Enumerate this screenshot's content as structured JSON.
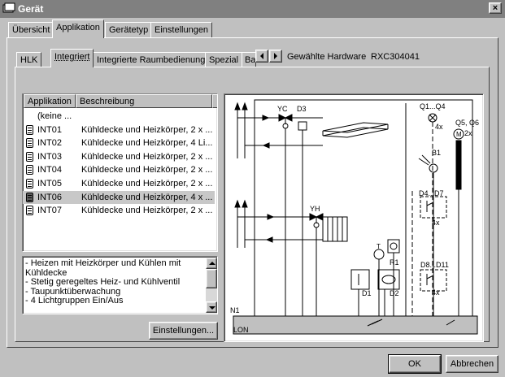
{
  "window": {
    "title": "Gerät",
    "close_symbol": "×"
  },
  "main_tabs": [
    {
      "label": "Übersicht"
    },
    {
      "label": "Applikation"
    },
    {
      "label": "Gerätetyp"
    },
    {
      "label": "Einstellungen"
    }
  ],
  "sub_tabs": [
    {
      "label": "HLK"
    },
    {
      "label": "Integriert"
    },
    {
      "label": "Integrierte Raumbedienung"
    },
    {
      "label": "Spezial"
    },
    {
      "label": "Ba"
    }
  ],
  "hardware": {
    "label": "Gewählte Hardware",
    "value": "RXC304041"
  },
  "list": {
    "col_app": "Applikation",
    "col_desc": "Beschreibung",
    "rows": [
      {
        "app": "(keine ...",
        "desc": ""
      },
      {
        "app": "INT01",
        "desc": "Kühldecke und Heizkörper,  2 x ..."
      },
      {
        "app": "INT02",
        "desc": "Kühldecke und Heizkörper, 4 Li..."
      },
      {
        "app": "INT03",
        "desc": "Kühldecke und Heizkörper, 2 x ..."
      },
      {
        "app": "INT04",
        "desc": "Kühldecke und Heizkörper, 2 x ..."
      },
      {
        "app": "INT05",
        "desc": "Kühldecke und Heizkörper, 2 x ..."
      },
      {
        "app": "INT06",
        "desc": "Kühldecke und Heizkörper, 4 x ..."
      },
      {
        "app": "INT07",
        "desc": "Kühldecke und Heizkörper, 2 x ..."
      }
    ],
    "selected_index": 6
  },
  "description": "- Heizen mit Heizkörper und Kühlen mit Kühldecke\n- Stetig geregeltes Heiz- und Kühlventil\n- Taupunktüberwachung\n- 4 Lichtgruppen Ein/Aus",
  "buttons": {
    "settings": "Einstellungen...",
    "ok": "OK",
    "cancel": "Abbrechen"
  },
  "diagram": {
    "labels": {
      "yc": "YC",
      "d3": "D3",
      "q1q4": "Q1...Q4",
      "q5q6": "Q5, Q6",
      "x4": "4x",
      "x2": "2x",
      "b1": "B1",
      "d4d7": "D4...D7",
      "x4b": "4x",
      "yh": "YH",
      "r1": "R1",
      "d1": "D1",
      "d2": "D2",
      "d8d11": "D8...D11",
      "x4c": "4x",
      "n1": "N1",
      "lon": "LON",
      "t": "T",
      "m": "M"
    }
  }
}
